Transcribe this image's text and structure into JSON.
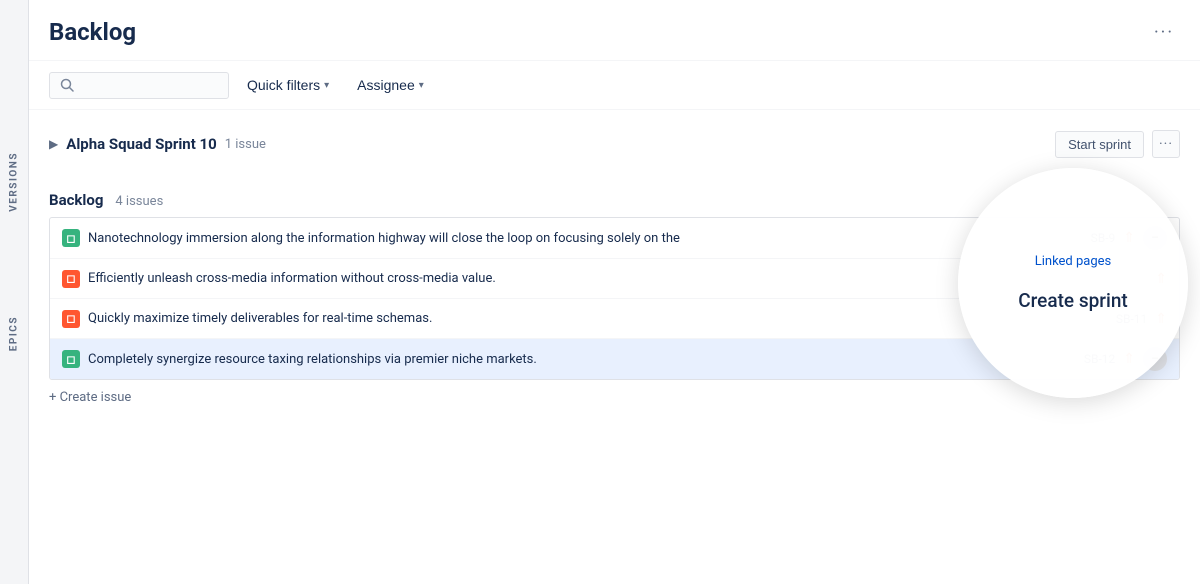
{
  "header": {
    "title": "Backlog",
    "more_icon": "···"
  },
  "toolbar": {
    "search_placeholder": "",
    "quick_filters_label": "Quick filters",
    "assignee_label": "Assignee"
  },
  "sprint_section": {
    "name": "Alpha Squad Sprint 10",
    "issue_count": "1 issue",
    "start_sprint_label": "Start sprint",
    "more_icon": "···"
  },
  "backlog_section": {
    "title": "Backlog",
    "issue_count": "4 issues",
    "create_issue_label": "+ Create issue"
  },
  "issues": [
    {
      "id": "issue-1",
      "type": "story",
      "summary": "Nanotechnology immersion along the information highway will close the loop on focusing solely on the",
      "issue_id": "SB-9",
      "has_priority": true,
      "has_action": true,
      "highlighted": false
    },
    {
      "id": "issue-2",
      "type": "bug",
      "summary": "Efficiently unleash cross-media information without cross-media value.",
      "issue_id": "",
      "has_priority": true,
      "has_action": false,
      "highlighted": false
    },
    {
      "id": "issue-3",
      "type": "bug",
      "summary": "Quickly maximize timely deliverables for real-time schemas.",
      "issue_id": "SB-11",
      "has_priority": true,
      "has_action": false,
      "highlighted": false
    },
    {
      "id": "issue-4",
      "type": "story",
      "summary": "Completely synergize resource taxing relationships via premier niche markets.",
      "issue_id": "SB-12",
      "has_priority": true,
      "has_action": true,
      "highlighted": true
    }
  ],
  "circle_popup": {
    "linked_pages_label": "Linked pages",
    "create_sprint_label": "Create sprint"
  },
  "side_labels": {
    "versions": "VERSIONS",
    "epics": "EPICS"
  }
}
